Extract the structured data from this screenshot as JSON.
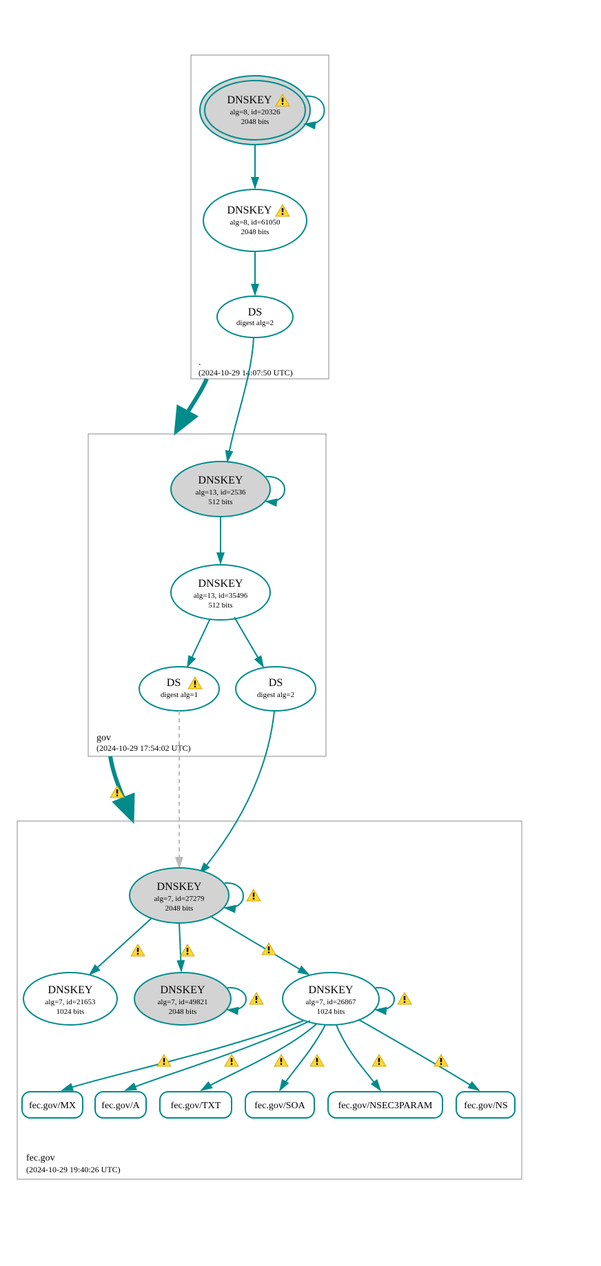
{
  "zones": {
    "root": {
      "label": ".",
      "timestamp": "(2024-10-29 14:07:50 UTC)"
    },
    "gov": {
      "label": "gov",
      "timestamp": "(2024-10-29 17:54:02 UTC)"
    },
    "fecgov": {
      "label": "fec.gov",
      "timestamp": "(2024-10-29 19:40:26 UTC)"
    }
  },
  "nodes": {
    "root_ksk": {
      "title": "DNSKEY",
      "line1": "alg=8, id=20326",
      "line2": "2048 bits",
      "warn": true
    },
    "root_zsk": {
      "title": "DNSKEY",
      "line1": "alg=8, id=61050",
      "line2": "2048 bits",
      "warn": true
    },
    "root_ds": {
      "title": "DS",
      "line1": "digest alg=2"
    },
    "gov_ksk": {
      "title": "DNSKEY",
      "line1": "alg=13, id=2536",
      "line2": "512 bits"
    },
    "gov_zsk": {
      "title": "DNSKEY",
      "line1": "alg=13, id=35496",
      "line2": "512 bits"
    },
    "gov_ds1": {
      "title": "DS",
      "line1": "digest alg=1",
      "warn": true
    },
    "gov_ds2": {
      "title": "DS",
      "line1": "digest alg=2"
    },
    "fec_ksk": {
      "title": "DNSKEY",
      "line1": "alg=7, id=27279",
      "line2": "2048 bits"
    },
    "fec_k1": {
      "title": "DNSKEY",
      "line1": "alg=7, id=21653",
      "line2": "1024 bits"
    },
    "fec_k2": {
      "title": "DNSKEY",
      "line1": "alg=7, id=49821",
      "line2": "2048 bits"
    },
    "fec_k3": {
      "title": "DNSKEY",
      "line1": "alg=7, id=26867",
      "line2": "1024 bits"
    }
  },
  "rr": {
    "mx": "fec.gov/MX",
    "a": "fec.gov/A",
    "txt": "fec.gov/TXT",
    "soa": "fec.gov/SOA",
    "nsec3": "fec.gov/NSEC3PARAM",
    "ns": "fec.gov/NS"
  }
}
